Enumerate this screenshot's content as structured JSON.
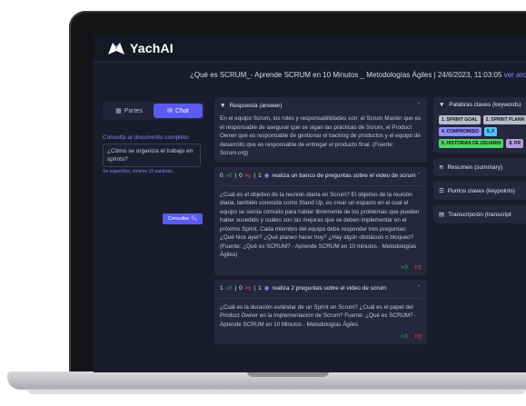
{
  "app": {
    "brand": "YachAI"
  },
  "header": {
    "title": "¿Qué es SCRUM_- Aprende SCRUM en 10 Minutos _ Metodologías Ágiles | 24/6/2023, 11:03:05",
    "link": "ver archivo"
  },
  "left": {
    "tabs": [
      "Partes",
      "Chat"
    ],
    "label": "Consulta al documento completo",
    "input_value": "¿Cómo se organiza el trabajo en sprints?",
    "hint": "Se específico, mínimo 15 palabras.",
    "consult_label": "Consultar"
  },
  "answer": {
    "title": "Respuesta (answer)",
    "text": "En el equipo Scrum, los roles y responsabilidades son: el Scrum Master que es el responsable de asegurar que se sigan las prácticas de Scrum, el Product Owner que es responsable de gestionar el backlog de productos y el equipo de desarrollo que es responsable de entregar el producto final. (Fuente: Scrum.org)"
  },
  "q1": {
    "likes": "0",
    "dislikes": "0",
    "views": "1",
    "title": "realiza un banco de preguntas sobre el video de scrum",
    "text": "¿Cuál es el objetivo de la reunión diaria en Scrum? El objetivo de la reunión diaria, también conocida como Stand Up, es crear un espacio en el cual el equipo se sienta cómodo para hablar libremente de los problemas que pueden haber sucedido y cuáles son las mejoras que se deben implementar en el próximo Sprint. Cada miembro del equipo debe responder tres preguntas: ¿Qué hice ayer? ¿Qué planeo hacer hoy? ¿Hay algún obstáculo o bloqueo? (Fuente: ¿Qué es SCRUM? - Aprende SCRUM en 10 minutos - Metodologías Ágiles)"
  },
  "q2": {
    "likes": "1",
    "dislikes": "0",
    "views": "1",
    "title": "realiza 2 preguntas sobre el video de scrum",
    "text": "¿Cuál es la duración estándar de un Sprint en Scrum? ¿Cuál es el papel del Product Owner en la implementación de Scrum? Fuente: ¿Qué es SCRUM? - Aprende SCRUM en 10 Minutos - Metodologías Ágiles"
  },
  "right": {
    "keywords_title": "Palabras claves (keywords)",
    "tags": [
      {
        "label": "1. SPRINT GOAL",
        "color": "#b9bccb"
      },
      {
        "label": "2. SPRINT PLANN",
        "color": "#b9bccb"
      },
      {
        "label": "3. DEMO",
        "color": "#4fc3f7"
      },
      {
        "label": "4. COMPROMISO",
        "color": "#8f8cff"
      },
      {
        "label": "5. F",
        "color": "#4fc3f7"
      },
      {
        "label": "5. HISTORIAS DE USUARIO",
        "color": "#4cd964"
      },
      {
        "label": "8. PR",
        "color": "#b39ddb"
      }
    ],
    "summary": "Resumen (summary)",
    "keypoints": "Puntos claves (keypoints)",
    "transcript": "Transcripción (transcript"
  }
}
